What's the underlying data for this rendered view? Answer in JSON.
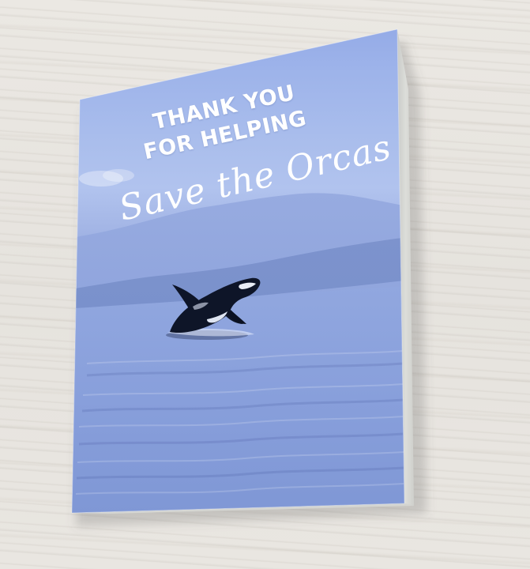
{
  "card": {
    "headline_line1": "THANK YOU",
    "headline_line2": "FOR HELPING",
    "script_line": "Save the Orcas"
  },
  "colors": {
    "sky": "#a9bdec",
    "water": "#8aa0d8",
    "mountain": "#7f95cf",
    "orca": "#0d1426",
    "table": "#e8e5e0"
  }
}
